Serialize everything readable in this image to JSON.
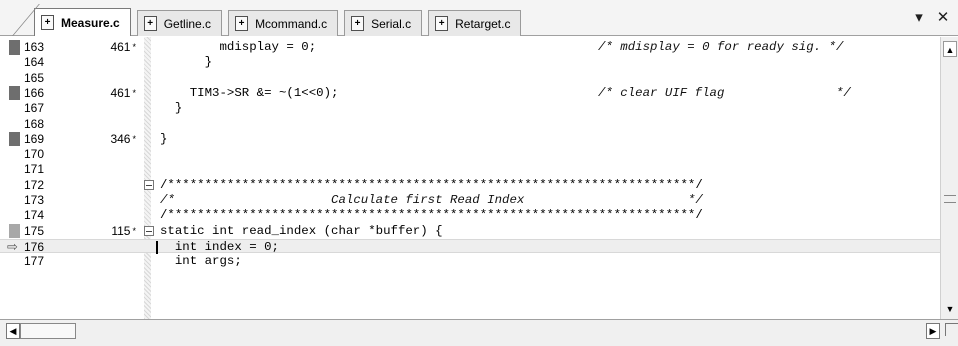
{
  "tabs": [
    {
      "label": "Measure.c",
      "active": true
    },
    {
      "label": "Getline.c",
      "active": false
    },
    {
      "label": "Mcommand.c",
      "active": false
    },
    {
      "label": "Serial.c",
      "active": false
    },
    {
      "label": "Retarget.c",
      "active": false
    }
  ],
  "tab_controls": {
    "dropdown": "▾",
    "close": "✕"
  },
  "lines": [
    {
      "num": "163",
      "exec": "461",
      "code": "        mdisplay = 0;",
      "comment": "/* mdisplay = 0 for ready sig. */",
      "mark": "dark"
    },
    {
      "num": "164",
      "exec": "",
      "code": "      }",
      "comment": "",
      "mark": "none"
    },
    {
      "num": "165",
      "exec": "",
      "code": "",
      "comment": "",
      "mark": "none"
    },
    {
      "num": "166",
      "exec": "461",
      "code": "    TIM3->SR &= ~(1<<0);",
      "comment": "/* clear UIF flag               */",
      "mark": "dark"
    },
    {
      "num": "167",
      "exec": "",
      "code": "  }",
      "comment": "",
      "mark": "none"
    },
    {
      "num": "168",
      "exec": "",
      "code": "",
      "comment": "",
      "mark": "none"
    },
    {
      "num": "169",
      "exec": "346",
      "code": "}",
      "comment": "",
      "mark": "dark"
    },
    {
      "num": "170",
      "exec": "",
      "code": "",
      "comment": "",
      "mark": "none"
    },
    {
      "num": "171",
      "exec": "",
      "code": "",
      "comment": "",
      "mark": "none"
    },
    {
      "num": "172",
      "exec": "",
      "code": "/***********************************************************************/",
      "comment": "",
      "mark": "none",
      "fold": true
    },
    {
      "num": "173",
      "exec": "",
      "code": "/*                     Calculate first Read Index                      */",
      "comment": "",
      "mark": "none",
      "italic": true
    },
    {
      "num": "174",
      "exec": "",
      "code": "/***********************************************************************/",
      "comment": "",
      "mark": "none"
    },
    {
      "num": "175",
      "exec": "115",
      "code": "static int read_index (char *buffer) {",
      "comment": "",
      "mark": "light",
      "fold": true
    },
    {
      "num": "176",
      "exec": "",
      "code": "  int index = 0;",
      "comment": "",
      "mark": "arrow",
      "current": true
    },
    {
      "num": "177",
      "exec": "",
      "code": "  int args;",
      "comment": "",
      "mark": "none"
    }
  ],
  "exec_suffix": "*",
  "arrow_glyph": "⇨",
  "scroll": {
    "up": "▲",
    "down": "▼",
    "left": "◀",
    "right": "▶"
  }
}
